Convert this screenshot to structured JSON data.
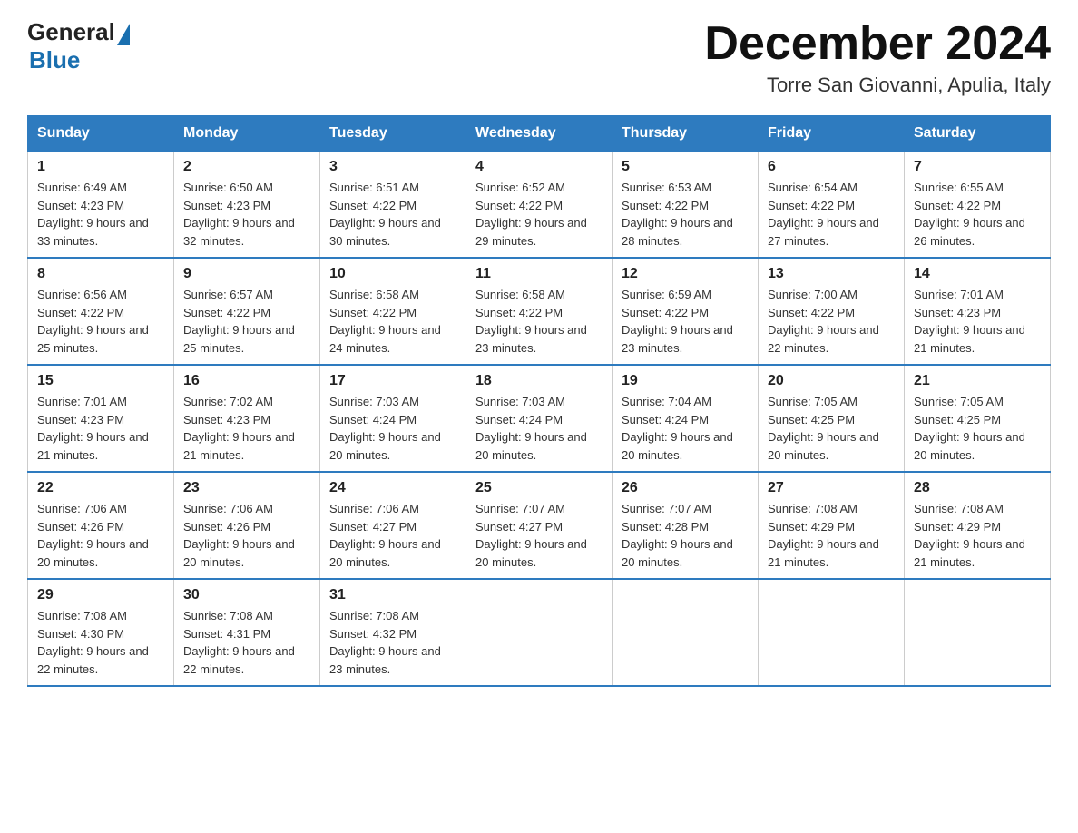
{
  "header": {
    "logo_general": "General",
    "logo_blue": "Blue",
    "title": "December 2024",
    "location": "Torre San Giovanni, Apulia, Italy"
  },
  "days_of_week": [
    "Sunday",
    "Monday",
    "Tuesday",
    "Wednesday",
    "Thursday",
    "Friday",
    "Saturday"
  ],
  "weeks": [
    [
      {
        "day": "1",
        "sunrise": "6:49 AM",
        "sunset": "4:23 PM",
        "daylight": "9 hours and 33 minutes."
      },
      {
        "day": "2",
        "sunrise": "6:50 AM",
        "sunset": "4:23 PM",
        "daylight": "9 hours and 32 minutes."
      },
      {
        "day": "3",
        "sunrise": "6:51 AM",
        "sunset": "4:22 PM",
        "daylight": "9 hours and 30 minutes."
      },
      {
        "day": "4",
        "sunrise": "6:52 AM",
        "sunset": "4:22 PM",
        "daylight": "9 hours and 29 minutes."
      },
      {
        "day": "5",
        "sunrise": "6:53 AM",
        "sunset": "4:22 PM",
        "daylight": "9 hours and 28 minutes."
      },
      {
        "day": "6",
        "sunrise": "6:54 AM",
        "sunset": "4:22 PM",
        "daylight": "9 hours and 27 minutes."
      },
      {
        "day": "7",
        "sunrise": "6:55 AM",
        "sunset": "4:22 PM",
        "daylight": "9 hours and 26 minutes."
      }
    ],
    [
      {
        "day": "8",
        "sunrise": "6:56 AM",
        "sunset": "4:22 PM",
        "daylight": "9 hours and 25 minutes."
      },
      {
        "day": "9",
        "sunrise": "6:57 AM",
        "sunset": "4:22 PM",
        "daylight": "9 hours and 25 minutes."
      },
      {
        "day": "10",
        "sunrise": "6:58 AM",
        "sunset": "4:22 PM",
        "daylight": "9 hours and 24 minutes."
      },
      {
        "day": "11",
        "sunrise": "6:58 AM",
        "sunset": "4:22 PM",
        "daylight": "9 hours and 23 minutes."
      },
      {
        "day": "12",
        "sunrise": "6:59 AM",
        "sunset": "4:22 PM",
        "daylight": "9 hours and 23 minutes."
      },
      {
        "day": "13",
        "sunrise": "7:00 AM",
        "sunset": "4:22 PM",
        "daylight": "9 hours and 22 minutes."
      },
      {
        "day": "14",
        "sunrise": "7:01 AM",
        "sunset": "4:23 PM",
        "daylight": "9 hours and 21 minutes."
      }
    ],
    [
      {
        "day": "15",
        "sunrise": "7:01 AM",
        "sunset": "4:23 PM",
        "daylight": "9 hours and 21 minutes."
      },
      {
        "day": "16",
        "sunrise": "7:02 AM",
        "sunset": "4:23 PM",
        "daylight": "9 hours and 21 minutes."
      },
      {
        "day": "17",
        "sunrise": "7:03 AM",
        "sunset": "4:24 PM",
        "daylight": "9 hours and 20 minutes."
      },
      {
        "day": "18",
        "sunrise": "7:03 AM",
        "sunset": "4:24 PM",
        "daylight": "9 hours and 20 minutes."
      },
      {
        "day": "19",
        "sunrise": "7:04 AM",
        "sunset": "4:24 PM",
        "daylight": "9 hours and 20 minutes."
      },
      {
        "day": "20",
        "sunrise": "7:05 AM",
        "sunset": "4:25 PM",
        "daylight": "9 hours and 20 minutes."
      },
      {
        "day": "21",
        "sunrise": "7:05 AM",
        "sunset": "4:25 PM",
        "daylight": "9 hours and 20 minutes."
      }
    ],
    [
      {
        "day": "22",
        "sunrise": "7:06 AM",
        "sunset": "4:26 PM",
        "daylight": "9 hours and 20 minutes."
      },
      {
        "day": "23",
        "sunrise": "7:06 AM",
        "sunset": "4:26 PM",
        "daylight": "9 hours and 20 minutes."
      },
      {
        "day": "24",
        "sunrise": "7:06 AM",
        "sunset": "4:27 PM",
        "daylight": "9 hours and 20 minutes."
      },
      {
        "day": "25",
        "sunrise": "7:07 AM",
        "sunset": "4:27 PM",
        "daylight": "9 hours and 20 minutes."
      },
      {
        "day": "26",
        "sunrise": "7:07 AM",
        "sunset": "4:28 PM",
        "daylight": "9 hours and 20 minutes."
      },
      {
        "day": "27",
        "sunrise": "7:08 AM",
        "sunset": "4:29 PM",
        "daylight": "9 hours and 21 minutes."
      },
      {
        "day": "28",
        "sunrise": "7:08 AM",
        "sunset": "4:29 PM",
        "daylight": "9 hours and 21 minutes."
      }
    ],
    [
      {
        "day": "29",
        "sunrise": "7:08 AM",
        "sunset": "4:30 PM",
        "daylight": "9 hours and 22 minutes."
      },
      {
        "day": "30",
        "sunrise": "7:08 AM",
        "sunset": "4:31 PM",
        "daylight": "9 hours and 22 minutes."
      },
      {
        "day": "31",
        "sunrise": "7:08 AM",
        "sunset": "4:32 PM",
        "daylight": "9 hours and 23 minutes."
      },
      null,
      null,
      null,
      null
    ]
  ]
}
